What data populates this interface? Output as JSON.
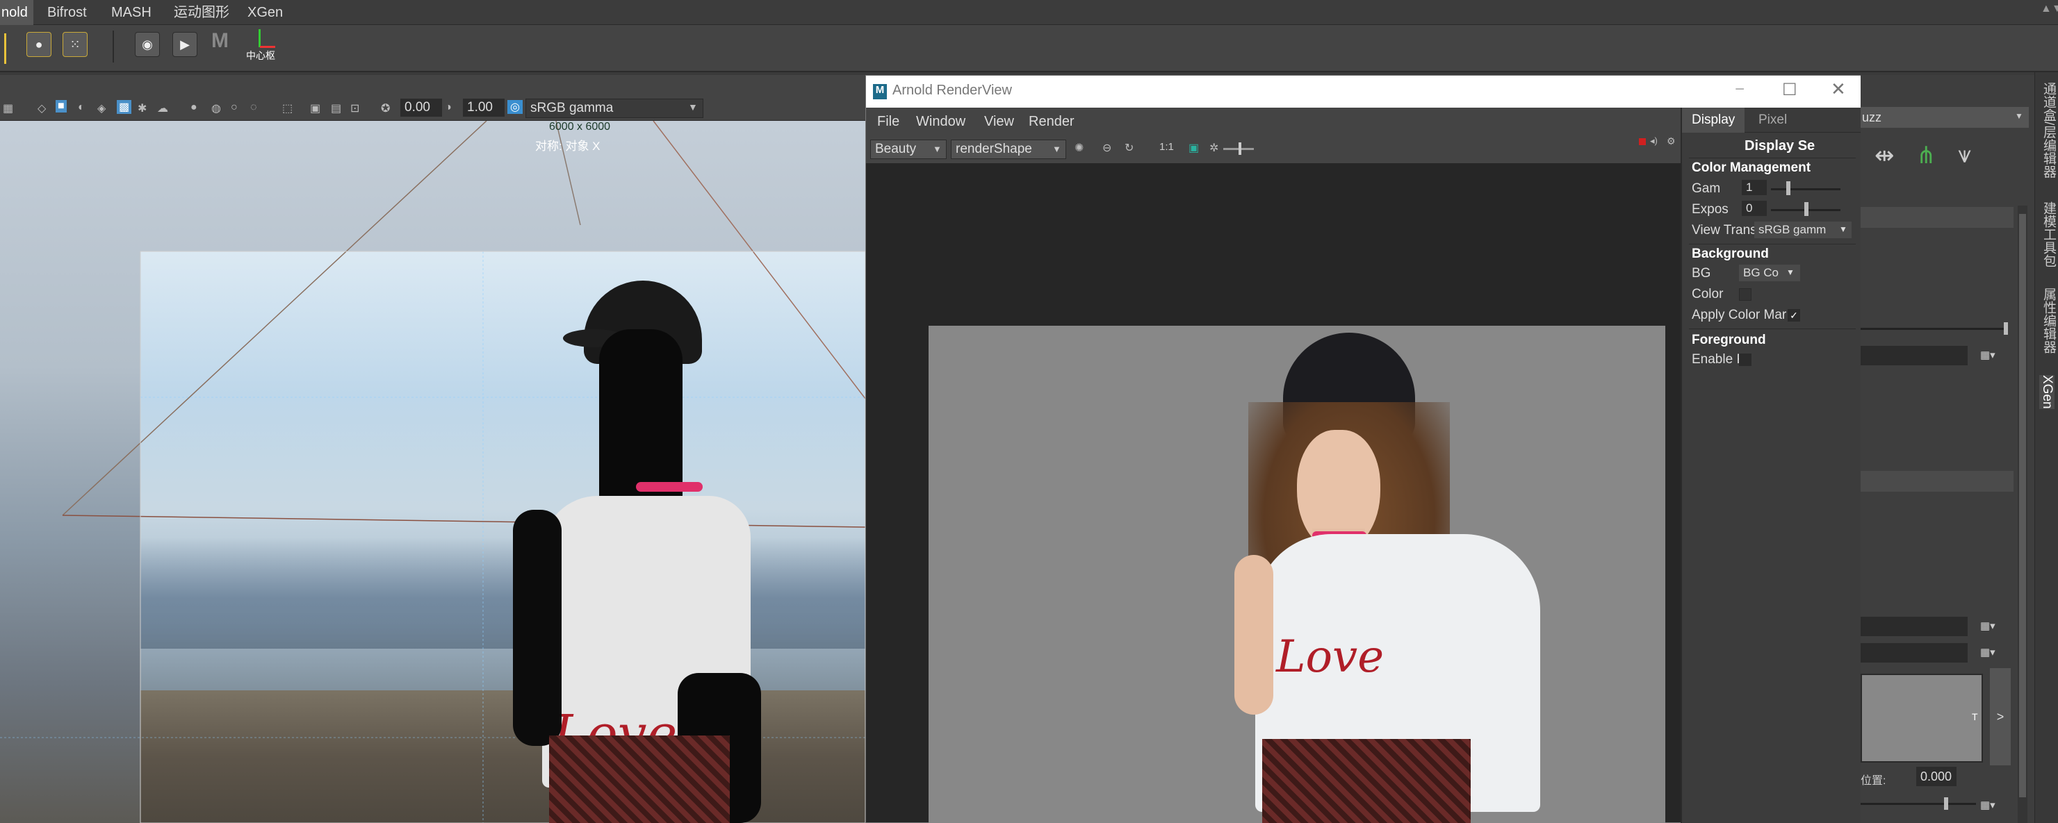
{
  "menubar": {
    "tabs": [
      "nold",
      "Bifrost",
      "MASH",
      "运动图形",
      "XGen"
    ]
  },
  "shelf": {
    "last_button_label": "中心枢"
  },
  "viewport": {
    "toolbar": {
      "value_a": "0.00",
      "value_b": "1.00",
      "colorspace": "sRGB gamma"
    },
    "resolution": "6000 x 6000",
    "symmetry": "对称: 对象 X",
    "overlay_text": "Love"
  },
  "renderview": {
    "title": "Arnold RenderView",
    "menus": [
      "File",
      "Window",
      "View",
      "Render"
    ],
    "aov": "Beauty",
    "camera": "renderShape",
    "ratio": "1:1",
    "tabs": [
      "Display",
      "Pixel"
    ],
    "panel": {
      "heading": "Display Se",
      "color_mgmt_heading": "Color Management",
      "gamma_label": "Gam",
      "gamma_value": "1",
      "exposure_label": "Expos",
      "exposure_value": "0",
      "view_transform_label": "View Trans",
      "view_transform_value": "sRGB gamm",
      "background_heading": "Background",
      "bg_label": "BG",
      "bg_value": "BG Co",
      "color_label": "Color",
      "apply_cm_label": "Apply Color Mar",
      "foreground_heading": "Foreground",
      "enable_label": "Enable F"
    }
  },
  "rightpanel": {
    "field_top": "uzz",
    "value_bottom": "0.000",
    "position_label": "位置:",
    "arrow_label": ">"
  },
  "vertical_tabs": [
    "通道盒/层编辑器",
    "建模工具包",
    "属性编辑器",
    "XGen"
  ],
  "colors": {
    "accent": "#4aa3ff",
    "choker": "#e0306a",
    "renderbg": "#888888"
  }
}
